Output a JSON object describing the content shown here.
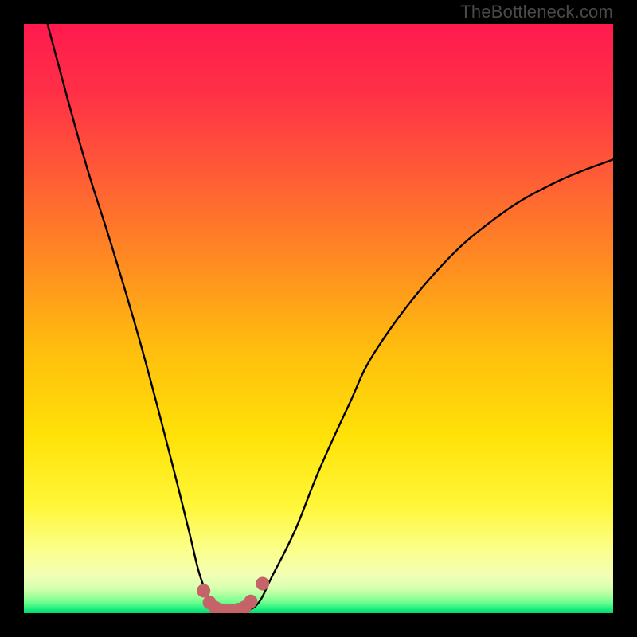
{
  "watermark": "TheBottleneck.com",
  "chart_data": {
    "type": "line",
    "title": "",
    "xlabel": "",
    "ylabel": "",
    "xlim": [
      0,
      100
    ],
    "ylim": [
      0,
      100
    ],
    "grid": false,
    "legend": false,
    "annotations": [],
    "series": [
      {
        "name": "bottleneck-curve",
        "x": [
          4,
          10,
          15,
          20,
          25,
          28,
          30,
          32,
          34,
          36,
          38,
          40,
          42,
          46,
          50,
          55,
          60,
          70,
          80,
          90,
          100
        ],
        "y": [
          100,
          78,
          62,
          45,
          26,
          14,
          6,
          2,
          0.5,
          0.5,
          0.5,
          2,
          6,
          14,
          24,
          35,
          45,
          58,
          67,
          73,
          77
        ],
        "color": "#000000"
      }
    ],
    "marker_points": {
      "name": "minimum-region-dots",
      "color": "#c56368",
      "x": [
        30.5,
        31.5,
        32.5,
        33.5,
        34.5,
        35.5,
        36.5,
        37.5,
        38.5,
        40.5
      ],
      "y": [
        3.8,
        1.8,
        0.9,
        0.5,
        0.4,
        0.4,
        0.6,
        1.0,
        2.0,
        5.0
      ]
    },
    "background": {
      "type": "vertical-gradient",
      "stops": [
        {
          "offset": 0.0,
          "color": "#ff1a4e"
        },
        {
          "offset": 0.12,
          "color": "#ff3146"
        },
        {
          "offset": 0.25,
          "color": "#ff5a37"
        },
        {
          "offset": 0.4,
          "color": "#ff8a22"
        },
        {
          "offset": 0.55,
          "color": "#ffbd0e"
        },
        {
          "offset": 0.7,
          "color": "#ffe208"
        },
        {
          "offset": 0.82,
          "color": "#fff73a"
        },
        {
          "offset": 0.89,
          "color": "#fcff88"
        },
        {
          "offset": 0.935,
          "color": "#f2ffb5"
        },
        {
          "offset": 0.957,
          "color": "#d8ffb0"
        },
        {
          "offset": 0.97,
          "color": "#aaff9e"
        },
        {
          "offset": 0.982,
          "color": "#6bff8e"
        },
        {
          "offset": 0.992,
          "color": "#23f07e"
        },
        {
          "offset": 1.0,
          "color": "#00d873"
        }
      ]
    }
  }
}
